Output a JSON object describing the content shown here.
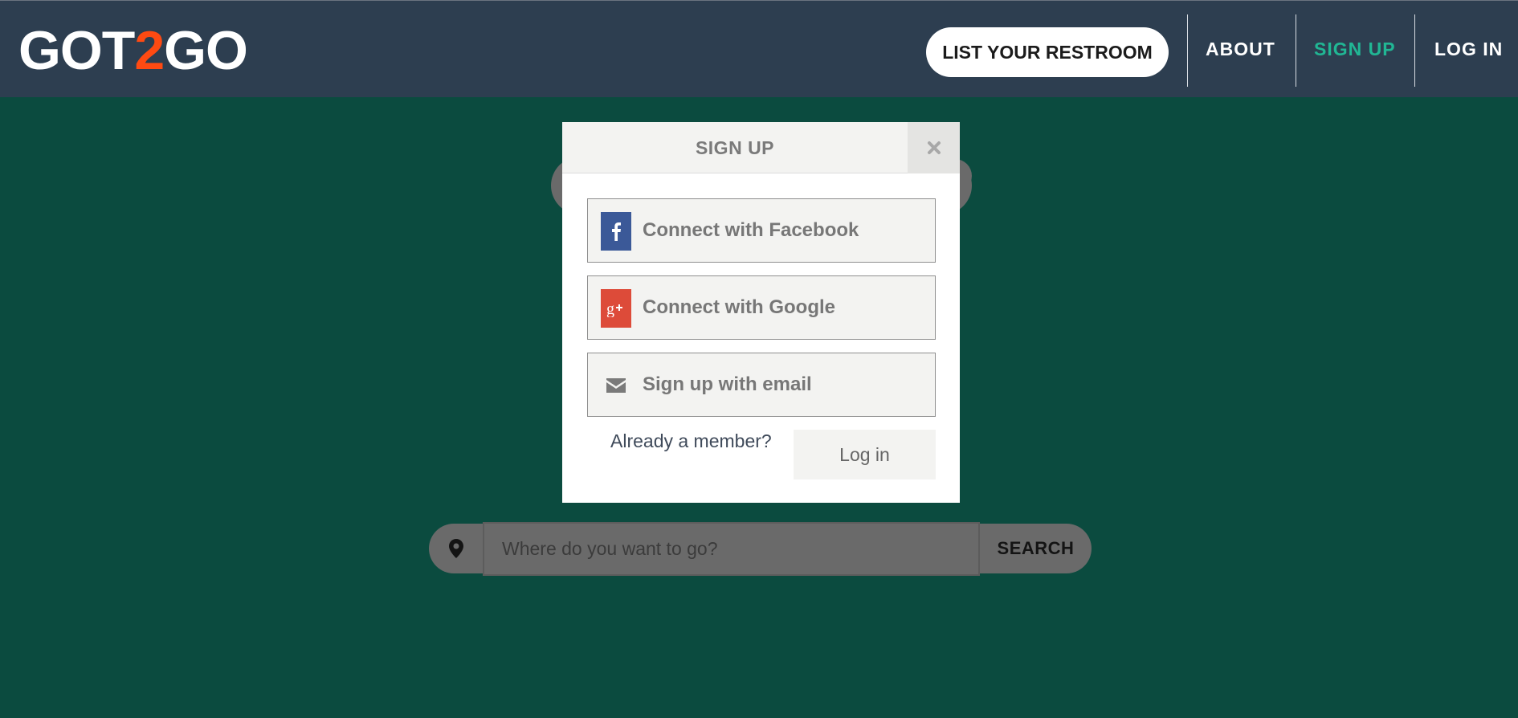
{
  "colors": {
    "page_background": "#0b4b3f",
    "header_background": "#2d3e50",
    "logo_accent": "#ff4a12",
    "active_nav": "#21b694",
    "facebook": "#3b5998",
    "google": "#dd4b39"
  },
  "header": {
    "logo": {
      "part1": "GOT",
      "part2": "2",
      "part3": "GO"
    },
    "list_button": "LIST YOUR RESTROOM",
    "nav": [
      {
        "label": "ABOUT",
        "active": false
      },
      {
        "label": "SIGN UP",
        "active": true
      },
      {
        "label": "LOG IN",
        "active": false
      }
    ]
  },
  "search": {
    "icon": "map-pin-icon",
    "placeholder": "Where do you want to go?",
    "button": "SEARCH"
  },
  "modal": {
    "title": "SIGN UP",
    "close_icon": "close-icon",
    "buttons": [
      {
        "icon": "facebook-icon",
        "label": "Connect with Facebook"
      },
      {
        "icon": "google-plus-icon",
        "label": "Connect with Google"
      },
      {
        "icon": "envelope-icon",
        "label": "Sign up with email"
      }
    ],
    "member_text": "Already a member?",
    "login_button": "Log in"
  }
}
